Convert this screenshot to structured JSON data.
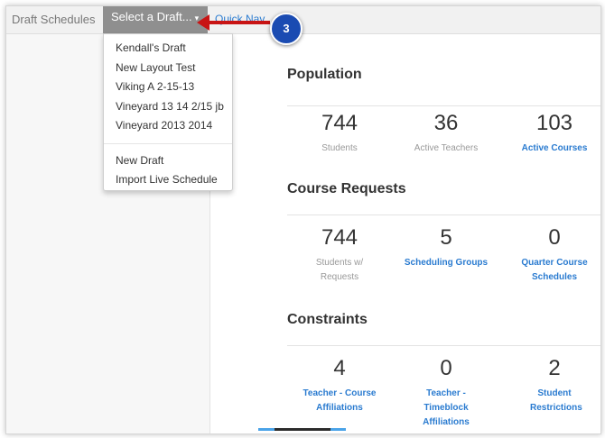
{
  "topbar": {
    "brand": "Draft Schedules",
    "select_draft_label": "Select a Draft...",
    "caret": "▾",
    "quick_link": "Quick Nav"
  },
  "dropdown": {
    "drafts": [
      "Kendall's Draft",
      "New Layout Test",
      "Viking A 2-15-13",
      "Vineyard 13 14 2/15 jb",
      "Vineyard 2013 2014"
    ],
    "actions": [
      "New Draft",
      "Import Live Schedule"
    ]
  },
  "callout": {
    "number": "3",
    "color": "#1a4bb2",
    "arrow_color": "#c81414"
  },
  "sections": {
    "population": {
      "title": "Population",
      "stats": [
        {
          "value": "744",
          "label": "Students"
        },
        {
          "value": "36",
          "label": "Active Teachers"
        },
        {
          "value": "103",
          "label": "Active Courses"
        }
      ]
    },
    "course_requests": {
      "title": "Course Requests",
      "stats": [
        {
          "value": "744",
          "label": "Students w/ Requests"
        },
        {
          "value": "5",
          "label": "Scheduling Groups"
        },
        {
          "value": "0",
          "label": "Quarter Course Schedules"
        }
      ]
    },
    "constraints": {
      "title": "Constraints",
      "stats": [
        {
          "value": "4",
          "label": "Teacher - Course Affiliations"
        },
        {
          "value": "0",
          "label": "Teacher - Timeblock Affiliations"
        },
        {
          "value": "2",
          "label": "Student Restrictions"
        }
      ]
    }
  },
  "colors": {
    "link": "#2a7bd0",
    "topbar_bg": "#f1f1f1",
    "select_bg": "#8f8f8f"
  }
}
